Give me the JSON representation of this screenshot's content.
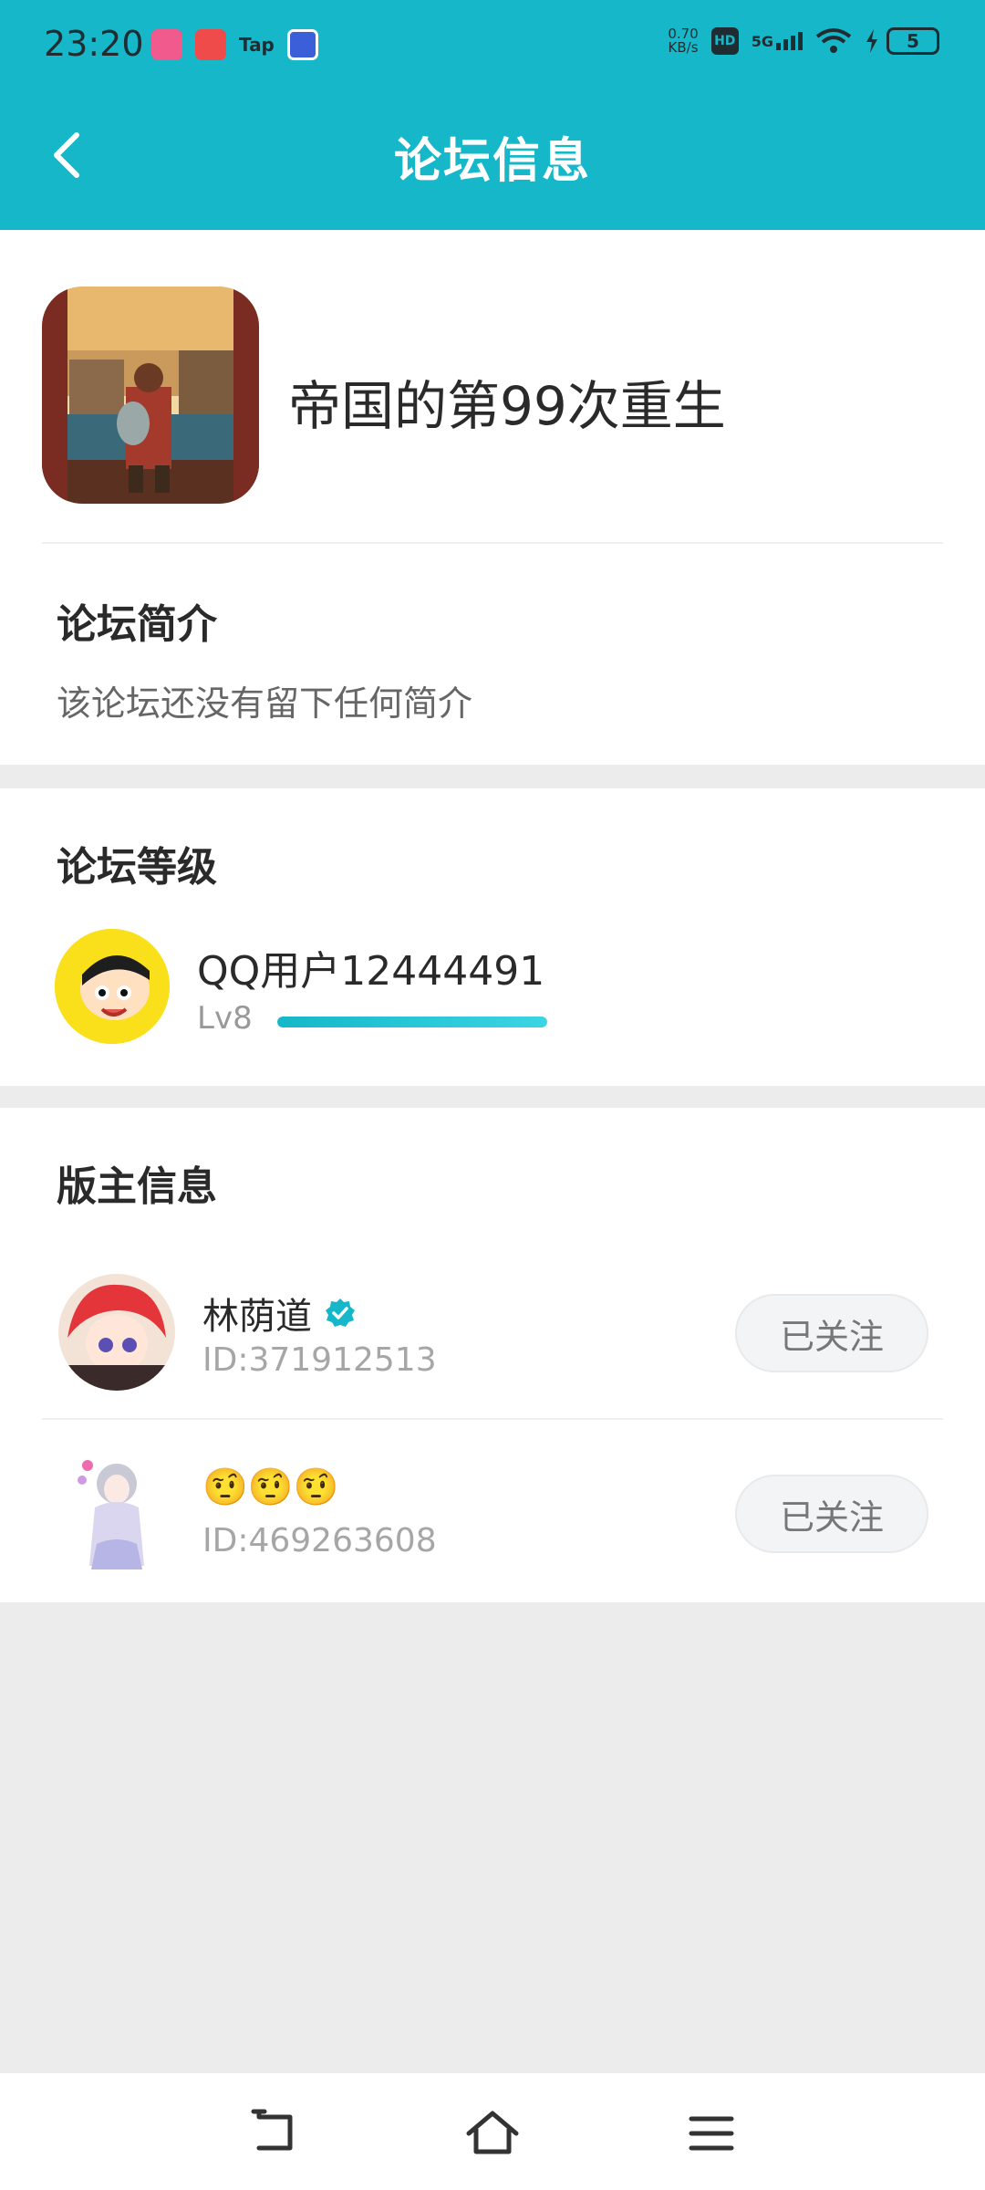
{
  "status_bar": {
    "time": "23:20",
    "net_speed_value": "0.70",
    "net_speed_unit": "KB/s",
    "hd_label": "HD",
    "signal_label": "5G",
    "battery_level": "5",
    "app_tap_label": "Tap"
  },
  "header": {
    "title": "论坛信息",
    "background_color": "#16b7c9"
  },
  "forum": {
    "name": "帝国的第99次重生"
  },
  "intro": {
    "title": "论坛简介",
    "text": "该论坛还没有留下任何简介"
  },
  "level": {
    "title": "论坛等级",
    "user_name": "QQ用户12444491",
    "level_label": "Lv8",
    "progress": 1.0
  },
  "moderators": {
    "title": "版主信息",
    "items": [
      {
        "name": "林荫道",
        "id": "ID:371912513",
        "follow_label": "已关注",
        "verified": true
      },
      {
        "name": "🤨🤨🤨",
        "id": "ID:469263608",
        "follow_label": "已关注",
        "verified": false
      }
    ]
  },
  "icons": {
    "back": "chevron-left-icon",
    "verified": "verified-badge-icon",
    "sys_back": "back-icon",
    "sys_home": "home-icon",
    "sys_menu": "menu-icon"
  }
}
